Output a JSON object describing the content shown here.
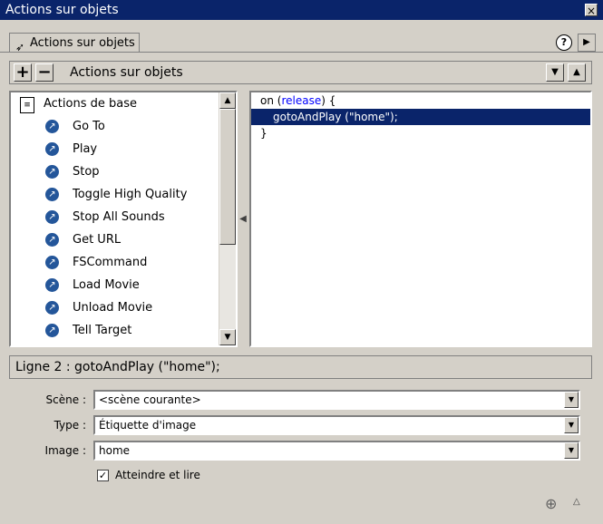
{
  "window": {
    "title": "Actions sur objets",
    "close_glyph": "×"
  },
  "tab": {
    "label": "Actions sur objets",
    "icon": "action-arrow-icon",
    "help_glyph": "?",
    "menu_glyph": "▶"
  },
  "toolbar": {
    "add_glyph": "+",
    "remove_glyph": "−",
    "title": "Actions sur objets",
    "move_down_glyph": "▼",
    "move_up_glyph": "▲"
  },
  "actions": {
    "category": "Actions de base",
    "items": [
      "Go To",
      "Play",
      "Stop",
      "Toggle High Quality",
      "Stop All Sounds",
      "Get URL",
      "FSCommand",
      "Load Movie",
      "Unload Movie",
      "Tell Target"
    ],
    "item_icon": "action-arrow-icon"
  },
  "code": {
    "line1_pre": "on (",
    "line1_kw": "release",
    "line1_post": ") {",
    "line2": "gotoAndPlay (\"home\");",
    "line3": "}"
  },
  "status": {
    "text": "Ligne 2 : gotoAndPlay (\"home\");"
  },
  "form": {
    "scene_label": "Scène :",
    "scene_value": "<scène courante>",
    "type_label": "Type :",
    "type_value": "Étiquette d'image",
    "image_label": "Image :",
    "image_value": "home",
    "checkbox_label": "Atteindre et lire",
    "checkbox_checked": true
  },
  "colors": {
    "titlebar": "#0a246a",
    "selection": "#0a246a",
    "keyword": "#0000ff",
    "panel": "#d4d0c8"
  }
}
